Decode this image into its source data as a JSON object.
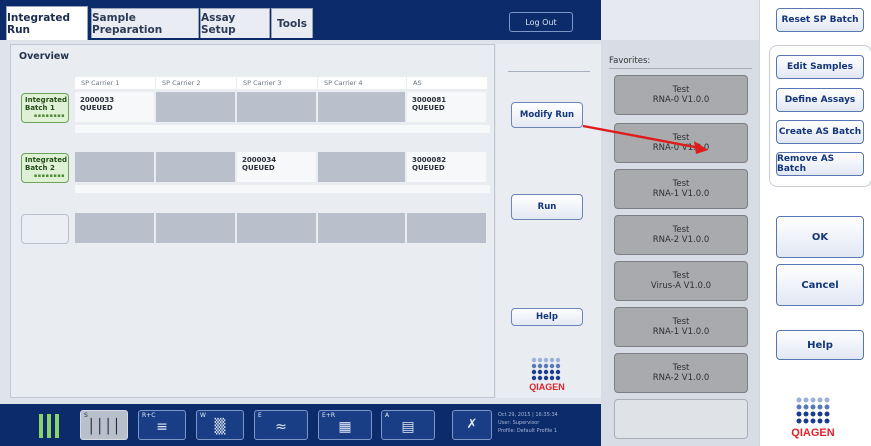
{
  "tabs": [
    {
      "label": "Integrated Run",
      "active": true
    },
    {
      "label": "Sample Preparation",
      "active": false
    },
    {
      "label": "Assay Setup",
      "active": false
    },
    {
      "label": "Tools",
      "active": false
    }
  ],
  "logout_label": "Log Out",
  "overview": {
    "title": "Overview",
    "columns": [
      "SP Carrier 1",
      "SP Carrier 2",
      "SP Carrier 3",
      "SP Carrier 4",
      "AS"
    ],
    "batches": [
      {
        "label": "Integrated\nBatch 1",
        "cells": [
          {
            "id": "2000033",
            "status": "QUEUED"
          },
          null,
          null,
          null,
          {
            "id": "3000081",
            "status": "QUEUED"
          }
        ]
      },
      {
        "label": "Integrated\nBatch 2",
        "cells": [
          null,
          null,
          {
            "id": "2000034",
            "status": "QUEUED"
          },
          null,
          {
            "id": "3000082",
            "status": "QUEUED"
          }
        ]
      },
      {
        "label": "",
        "cells": [
          null,
          null,
          null,
          null,
          null
        ]
      }
    ]
  },
  "side_buttons": {
    "modify_run": "Modify Run",
    "run": "Run",
    "help": "Help"
  },
  "bottombar": {
    "icons": [
      {
        "code": "S",
        "glyph": "││││"
      },
      {
        "code": "R+C",
        "glyph": "≡"
      },
      {
        "code": "W",
        "glyph": "▒"
      },
      {
        "code": "E",
        "glyph": "≈"
      },
      {
        "code": "E+R",
        "glyph": "▦"
      },
      {
        "code": "A",
        "glyph": "▤"
      }
    ],
    "info_lines": [
      "Oct 29, 2015 | 16:35:34",
      "User:    Supervisor",
      "Profile:  Default Profile 1"
    ]
  },
  "favorites": {
    "title": "Favorites:",
    "items": [
      {
        "line1": "Test",
        "line2": "RNA-0 V1.0.0"
      },
      {
        "line1": "Test",
        "line2": "RNA-0 V1.0.0"
      },
      {
        "line1": "Test",
        "line2": "RNA-1 V1.0.0"
      },
      {
        "line1": "Test",
        "line2": "RNA-2 V1.0.0"
      },
      {
        "line1": "Test",
        "line2": "Virus-A V1.0.0"
      },
      {
        "line1": "Test",
        "line2": "RNA-1 V1.0.0"
      },
      {
        "line1": "Test",
        "line2": "RNA-2 V1.0.0"
      }
    ]
  },
  "dialog": {
    "reset_sp_batch": "Reset SP Batch",
    "edit_samples": "Edit Samples",
    "define_assays": "Define Assays",
    "create_as_batch": "Create AS Batch",
    "remove_as_batch": "Remove AS Batch",
    "ok": "OK",
    "cancel": "Cancel",
    "help": "Help"
  },
  "brand": "QIAGEN",
  "colors": {
    "navy": "#0c2b6b",
    "button_text": "#13357a",
    "batch_green": "#dff1d4",
    "arrow_red": "#e01b1b"
  }
}
